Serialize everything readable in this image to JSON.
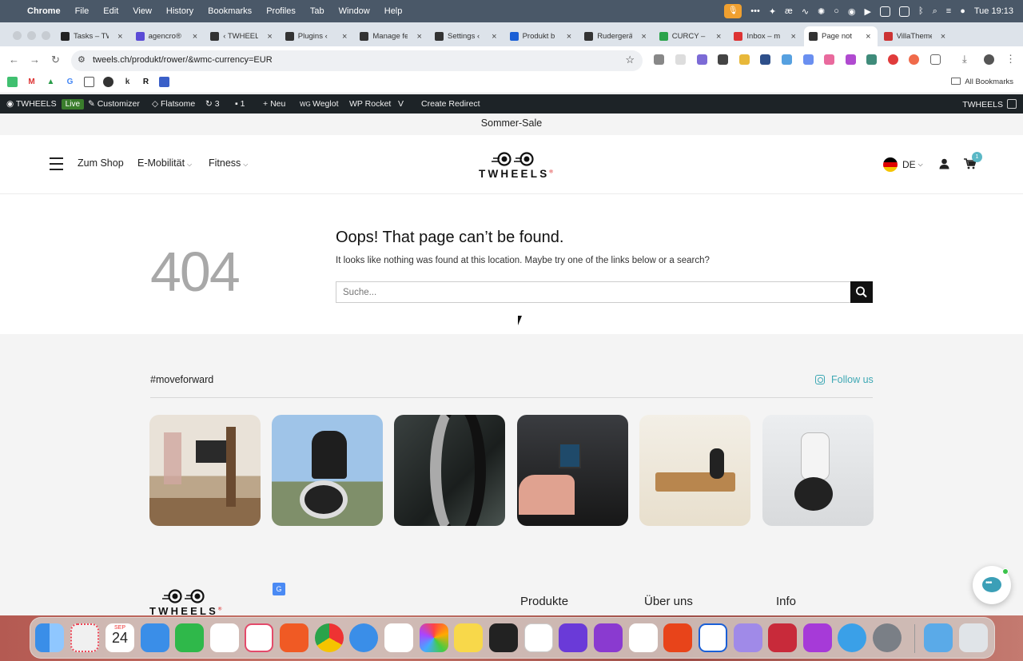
{
  "menubar": {
    "app": "Chrome",
    "items": [
      "File",
      "Edit",
      "View",
      "History",
      "Bookmarks",
      "Profiles",
      "Tab",
      "Window",
      "Help"
    ],
    "time": "Tue 19:13"
  },
  "tabs": [
    {
      "label": "Tasks – TW",
      "color": "#222"
    },
    {
      "label": "agencro®",
      "color": "#5b4bd6"
    },
    {
      "label": "‹ TWHEELS",
      "color": "#333"
    },
    {
      "label": "Plugins ‹",
      "color": "#333"
    },
    {
      "label": "Manage fe",
      "color": "#333"
    },
    {
      "label": "Settings ‹",
      "color": "#333"
    },
    {
      "label": "Produkt b",
      "color": "#1a5fd6"
    },
    {
      "label": "Rudergerät",
      "color": "#333"
    },
    {
      "label": "CURCY –",
      "color": "#2aa34a"
    },
    {
      "label": "Inbox – m",
      "color": "#d33"
    },
    {
      "label": "Page not",
      "color": "#333",
      "active": true
    },
    {
      "label": "VillaTheme",
      "color": "#c33"
    }
  ],
  "address": {
    "url": "tweels.ch/produkt/rower/&wmc-currency=EUR"
  },
  "bookmarks": {
    "all": "All Bookmarks"
  },
  "wpbar": {
    "site": "TWHEELS",
    "live": "Live",
    "customizer": "Customizer",
    "flatsome": "Flatsome",
    "updates": "3",
    "comments": "1",
    "new": "Neu",
    "weglot": "Weglot",
    "rocket": "WP Rocket",
    "redirect": "Create Redirect",
    "right": "TWHEELS"
  },
  "site": {
    "sale": "Sommer-Sale",
    "nav": [
      "Zum Shop",
      "E-Mobilität",
      "Fitness"
    ],
    "logo": "TWHEELS",
    "lang": "DE",
    "cart_count": "1",
    "error_code": "404",
    "error_title": "Oops! That page can’t be found.",
    "error_text": "It looks like nothing was found at this location. Maybe try one of the links below or a search?",
    "search_placeholder": "Suche...",
    "hashtag": "#moveforward",
    "follow": "Follow us",
    "footer_cols": [
      "Produkte",
      "Über uns",
      "Info"
    ]
  },
  "dock": {
    "calendar_month": "SEP",
    "calendar_day": "24"
  }
}
